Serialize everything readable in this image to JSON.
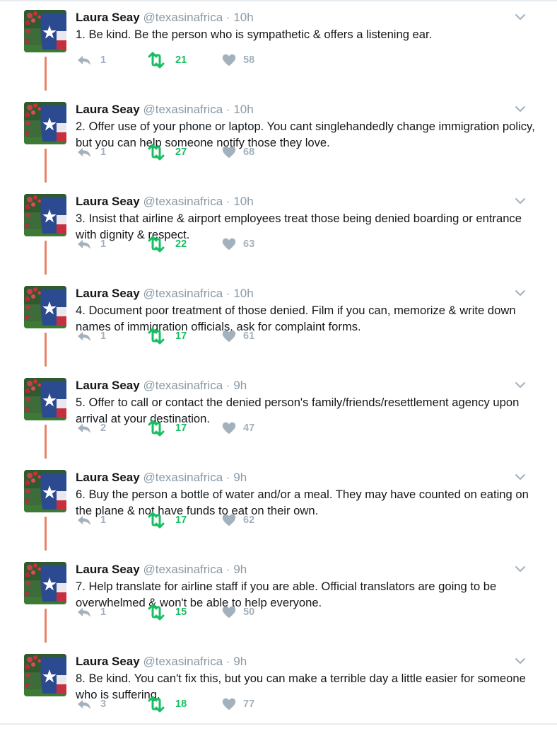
{
  "accent": {
    "retweet_color": "#17bf63",
    "muted_color": "#8899a6",
    "thread_line_color": "#e8836a"
  },
  "icons": {
    "reply": "reply-arrow-icon",
    "retweet": "retweet-icon",
    "like": "heart-icon",
    "menu": "chevron-down-icon",
    "avatar": "texas-flag-avatar"
  },
  "tweets": [
    {
      "name": "Laura Seay",
      "handle": "@texasinafrica",
      "dot": "·",
      "time": "10h",
      "text": "1. Be kind. Be the person who is sympathetic & offers a listening ear.",
      "replies": "1",
      "retweets": "21",
      "likes": "58"
    },
    {
      "name": "Laura Seay",
      "handle": "@texasinafrica",
      "dot": "·",
      "time": "10h",
      "text": "2. Offer use of your phone or laptop. You cant singlehandedly change immigration policy, but you can help someone notify those they love.",
      "replies": "1",
      "retweets": "27",
      "likes": "68"
    },
    {
      "name": "Laura Seay",
      "handle": "@texasinafrica",
      "dot": "·",
      "time": "10h",
      "text": "3. Insist that airline & airport employees treat those being denied boarding or entrance with dignity & respect.",
      "replies": "1",
      "retweets": "22",
      "likes": "63"
    },
    {
      "name": "Laura Seay",
      "handle": "@texasinafrica",
      "dot": "·",
      "time": "10h",
      "text": "4. Document poor treatment of those denied. Film if you can, memorize & write down names of immigration officials, ask for complaint forms.",
      "replies": "1",
      "retweets": "17",
      "likes": "61"
    },
    {
      "name": "Laura Seay",
      "handle": "@texasinafrica",
      "dot": "·",
      "time": "9h",
      "text": "5. Offer to call or contact the denied person's family/friends/resettlement agency upon arrival at your destination.",
      "replies": "2",
      "retweets": "17",
      "likes": "47"
    },
    {
      "name": "Laura Seay",
      "handle": "@texasinafrica",
      "dot": "·",
      "time": "9h",
      "text": "6. Buy the person a bottle of water and/or a meal. They may have counted on eating on the plane & not have funds to eat on their own.",
      "replies": "1",
      "retweets": "17",
      "likes": "62"
    },
    {
      "name": "Laura Seay",
      "handle": "@texasinafrica",
      "dot": "·",
      "time": "9h",
      "text": "7. Help translate for airline staff if you are able. Official translators are going to be overwhelmed & won't be able to help everyone.",
      "replies": "1",
      "retweets": "15",
      "likes": "50"
    },
    {
      "name": "Laura Seay",
      "handle": "@texasinafrica",
      "dot": "·",
      "time": "9h",
      "text": "8. Be kind. You can't fix this, but you can make a terrible day a little easier for someone who is suffering.",
      "replies": "3",
      "retweets": "18",
      "likes": "77"
    }
  ]
}
